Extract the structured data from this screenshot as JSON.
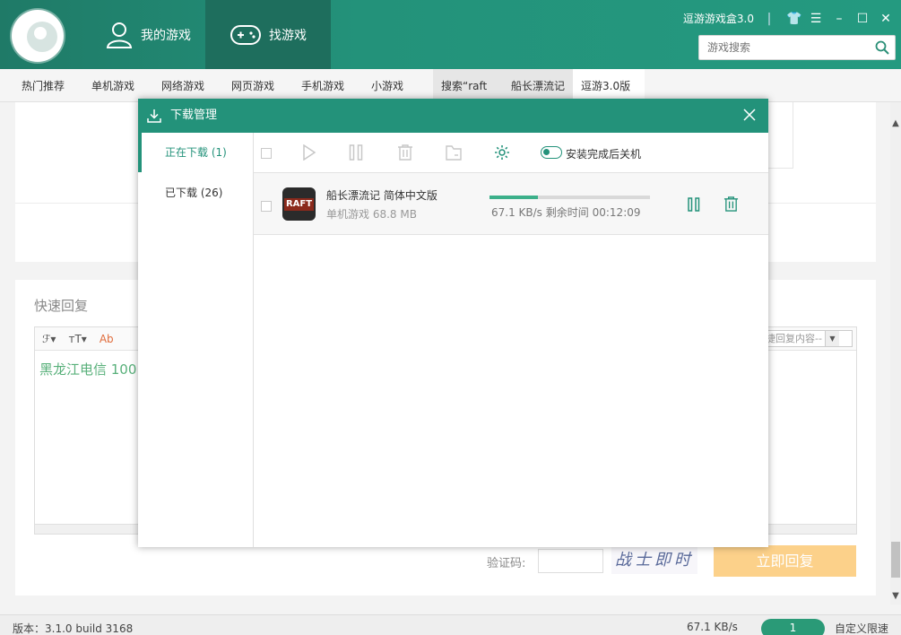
{
  "app": {
    "title": "逗游游戏盒3.0",
    "nav_tabs": [
      {
        "label": "我的游戏",
        "icon": "user-icon"
      },
      {
        "label": "找游戏",
        "icon": "gamepad-icon"
      }
    ],
    "window_icons": [
      "tshirt-icon",
      "menu-icon",
      "minimize-icon",
      "maximize-icon",
      "close-icon"
    ],
    "accent": "#23927a"
  },
  "search": {
    "placeholder": "游戏搜索"
  },
  "subnav": {
    "items": [
      "热门推荐",
      "单机游戏",
      "网络游戏",
      "网页游戏",
      "手机游戏",
      "小游戏"
    ],
    "tabs": [
      "搜索“raft",
      "船长漂流记",
      "逗游3.0版"
    ]
  },
  "reply": {
    "title": "快速回复",
    "toolbar": [
      "ℱ▾",
      "тT▾",
      "Ab"
    ],
    "quick_select": "捷回复内容--",
    "text": "黑龙江电信 100",
    "captcha_label": "验证码:",
    "captcha_text": "战士即时",
    "submit_label": "立即回复"
  },
  "statusbar": {
    "version": "版本：3.1.0 build 3168",
    "speed": "67.1 KB/s",
    "badge": "1",
    "limit": "自定义限速"
  },
  "download_manager": {
    "title": "下载管理",
    "sidebar": [
      "正在下载 (1)",
      "已下载 (26)"
    ],
    "toggle_label": "安装完成后关机",
    "item": {
      "icon_text": "RAFT",
      "name": "船长漂流记 简体中文版",
      "category": "单机游戏",
      "size": "68.8 MB",
      "speed": "67.1 KB/s",
      "remaining_label": "剩余时间",
      "remaining": "00:12:09",
      "progress": 0.3
    }
  }
}
